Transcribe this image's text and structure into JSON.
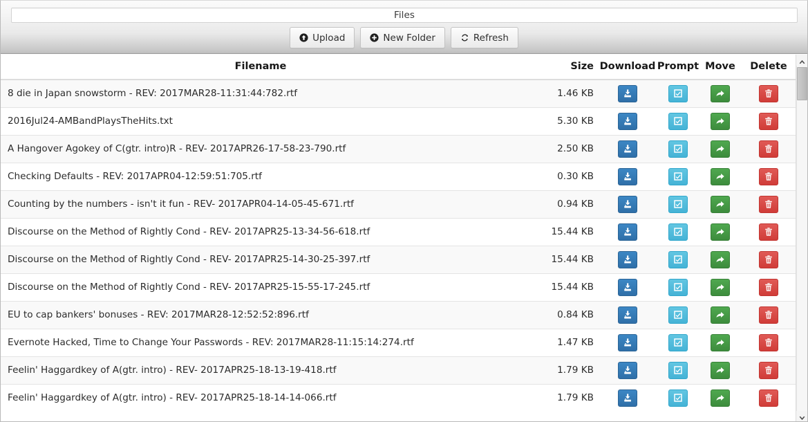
{
  "header": {
    "title": "Files",
    "buttons": [
      {
        "label": "Upload",
        "icon": "arrow-circle-up-icon"
      },
      {
        "label": "New Folder",
        "icon": "plus-circle-icon"
      },
      {
        "label": "Refresh",
        "icon": "refresh-icon"
      }
    ]
  },
  "table": {
    "columns": {
      "filename": "Filename",
      "size": "Size",
      "download": "Download",
      "prompt": "Prompt",
      "move": "Move",
      "delete": "Delete"
    },
    "action_icons": {
      "download": "download-icon",
      "prompt": "check-square-icon",
      "move": "share-arrow-icon",
      "delete": "trash-icon"
    },
    "action_colors": {
      "download": "#337ab7",
      "prompt": "#5bc0de",
      "move": "#449d44",
      "delete": "#d9534f"
    },
    "rows": [
      {
        "filename": "8 die in Japan snowstorm - REV: 2017MAR28-11:31:44:782.rtf",
        "size": "1.46 KB"
      },
      {
        "filename": "2016Jul24-AMBandPlaysTheHits.txt",
        "size": "5.30 KB"
      },
      {
        "filename": "A Hangover Agokey of C(gtr. intro)R - REV- 2017APR26-17-58-23-790.rtf",
        "size": "2.50 KB"
      },
      {
        "filename": "Checking Defaults - REV: 2017APR04-12:59:51:705.rtf",
        "size": "0.30 KB"
      },
      {
        "filename": "Counting by the numbers - isn't it fun - REV- 2017APR04-14-05-45-671.rtf",
        "size": "0.94 KB"
      },
      {
        "filename": "Discourse on the Method of Rightly Cond - REV- 2017APR25-13-34-56-618.rtf",
        "size": "15.44 KB"
      },
      {
        "filename": "Discourse on the Method of Rightly Cond - REV- 2017APR25-14-30-25-397.rtf",
        "size": "15.44 KB"
      },
      {
        "filename": "Discourse on the Method of Rightly Cond - REV- 2017APR25-15-55-17-245.rtf",
        "size": "15.44 KB"
      },
      {
        "filename": "EU to cap bankers' bonuses - REV: 2017MAR28-12:52:52:896.rtf",
        "size": "0.84 KB"
      },
      {
        "filename": "Evernote Hacked, Time to Change Your Passwords - REV: 2017MAR28-11:15:14:274.rtf",
        "size": "1.47 KB"
      },
      {
        "filename": "Feelin' Haggardkey of A(gtr. intro) - REV- 2017APR25-18-13-19-418.rtf",
        "size": "1.79 KB"
      },
      {
        "filename": "Feelin' Haggardkey of A(gtr. intro) - REV- 2017APR25-18-14-14-066.rtf",
        "size": "1.79 KB"
      }
    ]
  },
  "scrollbar": {
    "up_icon": "chevron-up-icon",
    "down_icon": "chevron-down-icon"
  }
}
